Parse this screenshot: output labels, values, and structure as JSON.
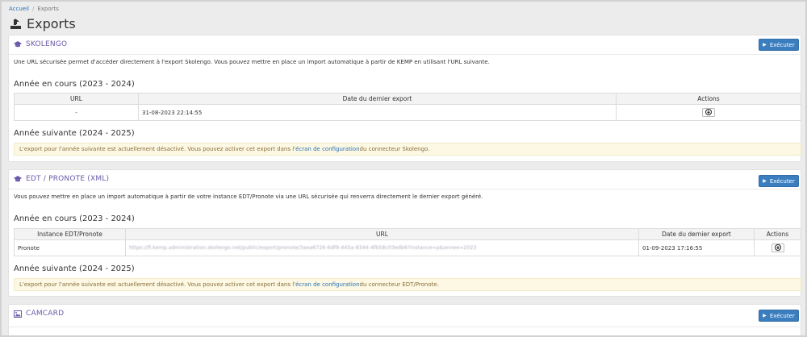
{
  "breadcrumb": {
    "home": "Accueil",
    "current": "Exports"
  },
  "page": {
    "title": "Exports"
  },
  "sections": {
    "skolengo": {
      "title": "SKOLENGO",
      "exec_label": "Exécuter",
      "description": "Une URL sécurisée permet d'accéder directement à l'export Skolengo. Vous pouvez mettre en place un import automatique à partir de KEMP en utilisant l'URL suivante.",
      "current_year_heading": "Année en cours (2023 - 2024)",
      "table": {
        "headers": [
          "URL",
          "Date du dernier export",
          "Actions"
        ],
        "row": {
          "url": "-",
          "date": "31-08-2023 22:14:55"
        }
      },
      "next_year_heading": "Année suivante (2024 - 2025)",
      "warning": {
        "before": "L'export pour l'année suivante est actuellement désactivé. Vous pouvez activer cet export dans l'",
        "link": "écran de configuration",
        "after": " du connecteur Skolengo."
      }
    },
    "edt": {
      "title": "EDT / PRONOTE (XML)",
      "exec_label": "Exécuter",
      "description": "Vous pouvez mettre en place un import automatique à partir de votre instance EDT/Pronote via une URL sécurisée qui renverra directement le dernier export généré.",
      "current_year_heading": "Année en cours (2023 - 2024)",
      "table": {
        "headers": [
          "Instance EDT/Pronote",
          "URL",
          "Date du dernier export",
          "Actions"
        ],
        "row": {
          "instance": "Pronote",
          "url": "https://fl.kemp.administration.skolengo.net/public/export/pronote/3aea6726-6df9-445a-8344-4fb58c03edb6?instance=p&annee=2023",
          "date": "01-09-2023 17:16:55"
        }
      },
      "next_year_heading": "Année suivante (2024 - 2025)",
      "warning": {
        "before": "L'export pour l'année suivante est actuellement désactivé. Vous pouvez activer cet export dans l'",
        "link": "écran de configuration",
        "after": " du connecteur EDT/Pronote."
      }
    },
    "camcard": {
      "title": "CAMCARD",
      "exec_label": "Exécuter"
    }
  },
  "colors": {
    "accent": "#3a7ebf",
    "section_title": "#6b5aa8",
    "warning_bg": "#fcf8e3"
  }
}
